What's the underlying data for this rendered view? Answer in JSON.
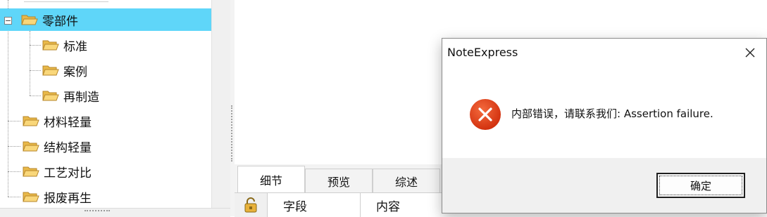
{
  "tree": {
    "items": [
      {
        "label": "零部件",
        "selected": true
      },
      {
        "label": "标准"
      },
      {
        "label": "案例"
      },
      {
        "label": "再制造"
      },
      {
        "label": "材料轻量"
      },
      {
        "label": "结构轻量"
      },
      {
        "label": "工艺对比"
      },
      {
        "label": "报废再生"
      }
    ],
    "expander_glyph": "−",
    "selected_color": "#5fd6f9"
  },
  "bottom_pane": {
    "tabs": [
      {
        "label": "细节",
        "active": true
      },
      {
        "label": "预览"
      },
      {
        "label": "综述"
      }
    ],
    "columns": [
      "字段",
      "内容"
    ],
    "lock_icon": "lock-icon"
  },
  "dialog": {
    "title": "NoteExpress",
    "message": "内部错误，请联系我们: Assertion failure.",
    "ok_label": "确定",
    "icon": "error-icon",
    "error_color": "#e3411c"
  }
}
